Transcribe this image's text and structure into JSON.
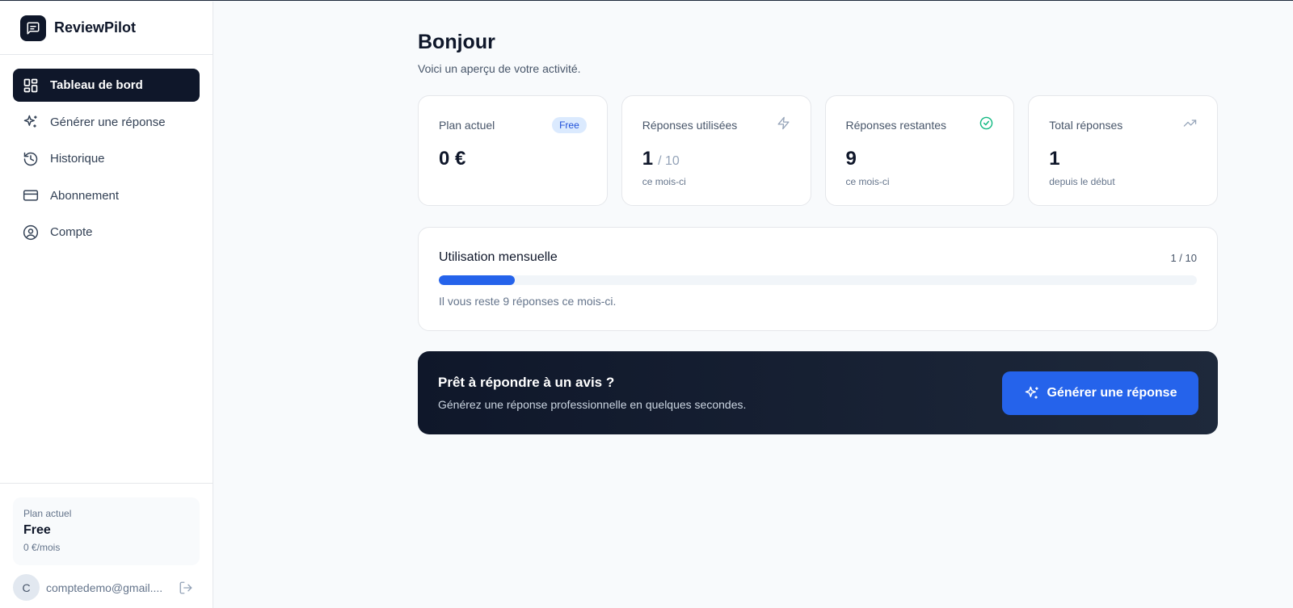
{
  "brand": {
    "name": "ReviewPilot",
    "logo_icon": "message-square-icon"
  },
  "sidebar": {
    "items": [
      {
        "label": "Tableau de bord",
        "icon": "layout-dashboard-icon",
        "active": true
      },
      {
        "label": "Générer une réponse",
        "icon": "sparkles-icon",
        "active": false
      },
      {
        "label": "Historique",
        "icon": "history-icon",
        "active": false
      },
      {
        "label": "Abonnement",
        "icon": "credit-card-icon",
        "active": false
      },
      {
        "label": "Compte",
        "icon": "user-circle-icon",
        "active": false
      }
    ],
    "plan": {
      "label": "Plan actuel",
      "name": "Free",
      "price": "0 €/mois"
    },
    "user": {
      "initial": "C",
      "email": "comptedemo@gmail...."
    }
  },
  "main": {
    "greeting": "Bonjour",
    "subtitle": "Voici un aperçu de votre activité.",
    "stats": [
      {
        "title": "Plan actuel",
        "badge": "Free",
        "value": "0 €",
        "total": "",
        "sub": ""
      },
      {
        "title": "Réponses utilisées",
        "icon": "zap-icon",
        "value": "1",
        "total": "/ 10",
        "sub": "ce mois-ci"
      },
      {
        "title": "Réponses restantes",
        "icon": "check-circle-icon",
        "value": "9",
        "total": "",
        "sub": "ce mois-ci"
      },
      {
        "title": "Total réponses",
        "icon": "trending-up-icon",
        "value": "1",
        "total": "",
        "sub": "depuis le début"
      }
    ],
    "usage": {
      "title": "Utilisation mensuelle",
      "count": "1 / 10",
      "used": 1,
      "limit": 10,
      "note": "Il vous reste 9 réponses ce mois-ci."
    },
    "cta": {
      "title": "Prêt à répondre à un avis ?",
      "subtitle": "Générez une réponse professionnelle en quelques secondes.",
      "button_label": "Générer une réponse"
    }
  },
  "colors": {
    "primary": "#2563eb",
    "dark": "#0f172a",
    "success": "#10b981",
    "badge_bg": "#dbeafe"
  }
}
